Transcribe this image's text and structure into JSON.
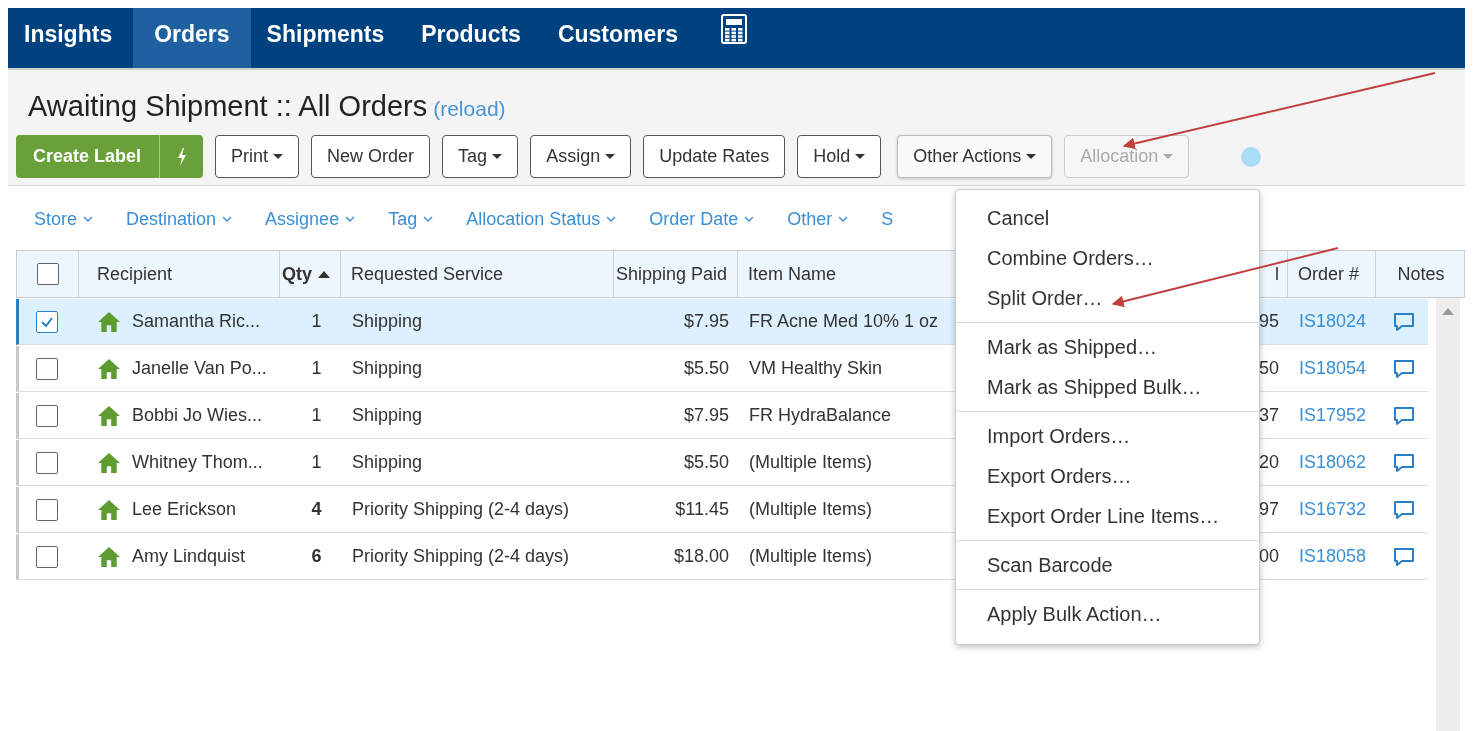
{
  "nav": [
    {
      "label": "Insights",
      "selected": false
    },
    {
      "label": "Orders",
      "selected": true
    },
    {
      "label": "Shipments",
      "selected": false
    },
    {
      "label": "Products",
      "selected": false
    },
    {
      "label": "Customers",
      "selected": false
    }
  ],
  "title": "Awaiting Shipment :: All Orders",
  "reload": "(reload)",
  "create_label": "Create Label",
  "buttons": [
    {
      "label": "Print",
      "caret": true,
      "disabled": false,
      "open": false
    },
    {
      "label": "New Order",
      "caret": false,
      "disabled": false,
      "open": false
    },
    {
      "label": "Tag",
      "caret": true,
      "disabled": false,
      "open": false
    },
    {
      "label": "Assign",
      "caret": true,
      "disabled": false,
      "open": false
    },
    {
      "label": "Update Rates",
      "caret": false,
      "disabled": false,
      "open": false
    },
    {
      "label": "Hold",
      "caret": true,
      "disabled": false,
      "open": false
    },
    {
      "label": "Other Actions",
      "caret": true,
      "disabled": false,
      "open": true
    },
    {
      "label": "Allocation",
      "caret": true,
      "disabled": true,
      "open": false
    }
  ],
  "filters": [
    {
      "label": "Store",
      "chevron": true
    },
    {
      "label": "Destination",
      "chevron": true
    },
    {
      "label": "Assignee",
      "chevron": true
    },
    {
      "label": "Tag",
      "chevron": true
    },
    {
      "label": "Allocation Status",
      "chevron": true
    },
    {
      "label": "Order Date",
      "chevron": true
    },
    {
      "label": "Other",
      "chevron": true
    },
    {
      "label": "S",
      "chevron": false
    }
  ],
  "table": {
    "all_checked": false,
    "columns": [
      {
        "label": "Recipient",
        "sorted": false
      },
      {
        "label": "Qty",
        "sorted": true
      },
      {
        "label": "Requested Service",
        "sorted": false
      },
      {
        "label": "Shipping Paid",
        "sorted": false
      },
      {
        "label": "Item Name",
        "sorted": false
      },
      {
        "label": "l",
        "sorted": false
      },
      {
        "label": "Order #",
        "sorted": false
      },
      {
        "label": "Notes",
        "sorted": false
      }
    ],
    "rows": [
      {
        "selected": true,
        "checked": true,
        "recipient": "Samantha Ric...",
        "qty": "1",
        "qty_bold": false,
        "service": "Shipping",
        "paid": "$7.95",
        "item": "FR Acne Med 10% 1 oz",
        "column_6": "95",
        "order": "IS18024"
      },
      {
        "selected": false,
        "checked": false,
        "recipient": "Janelle Van Po...",
        "qty": "1",
        "qty_bold": false,
        "service": "Shipping",
        "paid": "$5.50",
        "item": "VM Healthy Skin",
        "column_6": "50",
        "order": "IS18054"
      },
      {
        "selected": false,
        "checked": false,
        "recipient": "Bobbi Jo Wies...",
        "qty": "1",
        "qty_bold": false,
        "service": "Shipping",
        "paid": "$7.95",
        "item": "FR HydraBalance",
        "column_6": "37",
        "order": "IS17952"
      },
      {
        "selected": false,
        "checked": false,
        "recipient": "Whitney Thom...",
        "qty": "1",
        "qty_bold": false,
        "service": "Shipping",
        "paid": "$5.50",
        "item": "(Multiple Items)",
        "column_6": "20",
        "order": "IS18062"
      },
      {
        "selected": false,
        "checked": false,
        "recipient": "Lee Erickson",
        "qty": "4",
        "qty_bold": true,
        "service": "Priority Shipping (2-4 days)",
        "paid": "$11.45",
        "item": "(Multiple Items)",
        "column_6": "97",
        "order": "IS16732"
      },
      {
        "selected": false,
        "checked": false,
        "recipient": "Amy Lindquist",
        "qty": "6",
        "qty_bold": true,
        "service": "Priority Shipping (2-4 days)",
        "paid": "$18.00",
        "item": "(Multiple Items)",
        "column_6": "00",
        "order": "IS18058"
      }
    ]
  },
  "menu": {
    "groups": [
      {
        "items": [
          "Cancel",
          "Combine Orders…",
          "Split Order…"
        ]
      },
      {
        "items": [
          "Mark as Shipped…",
          "Mark as Shipped Bulk…"
        ]
      },
      {
        "items": [
          "Import Orders…",
          "Export Orders…",
          "Export Order Line Items…"
        ]
      },
      {
        "items": [
          "Scan Barcode"
        ]
      },
      {
        "items": [
          "Apply Bulk Action…"
        ]
      }
    ]
  }
}
